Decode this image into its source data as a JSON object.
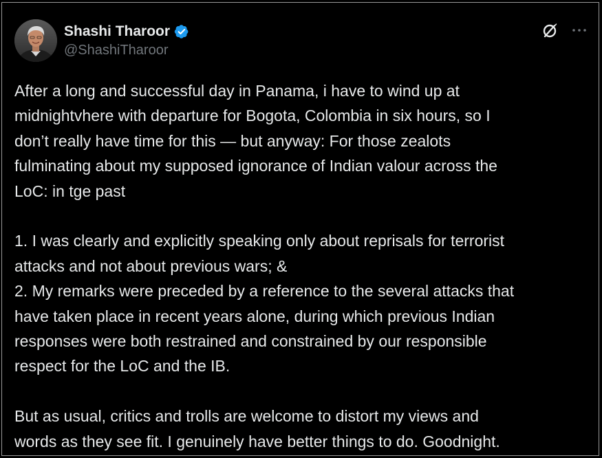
{
  "author": {
    "display_name": "Shashi Tharoor",
    "handle": "@ShashiTharoor",
    "verified": true,
    "avatar_icon": "user-avatar-photo",
    "verified_icon": "verified-badge-icon",
    "verified_color": "#1d9bf0"
  },
  "actions": {
    "grok_icon": "grok-icon",
    "more_icon": "more-options-icon"
  },
  "tweet": {
    "text": "After a long and successful day in Panama, i have to wind up at\nmidnightvhere with departure for Bogota, Colombia in six hours, so I\ndon’t really have time for this — but anyway: For those zealots\nfulminating about my supposed ignorance of Indian valour across the\nLoC: in tge past\n\n1. I was clearly and explicitly speaking only about reprisals for terrorist\nattacks and not about previous wars; &\n2. My remarks were preceded by a reference to the several attacks that\nhave taken place in recent years alone, during which previous Indian\nresponses were both restrained and constrained by our responsible\nrespect for the LoC and the IB.\n\nBut as usual, critics and trolls are welcome to distort my views and\nwords as they see fit. I genuinely have better things to do. Goodnight."
  },
  "colors": {
    "background": "#000000",
    "text_primary": "#e7e9ea",
    "text_secondary": "#71767b",
    "border": "#9a9a9a"
  }
}
